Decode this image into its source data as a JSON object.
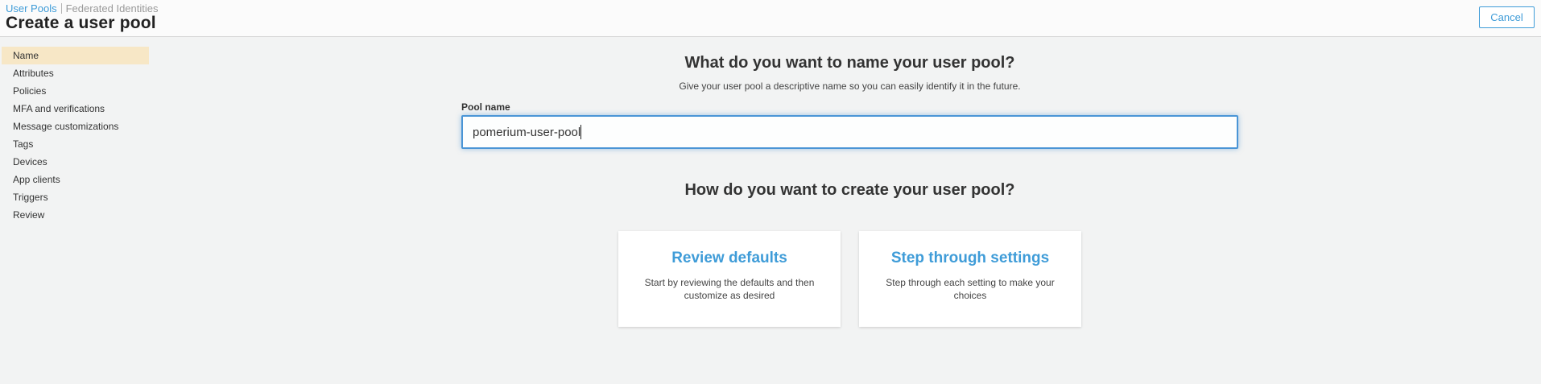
{
  "header": {
    "breadcrumb": {
      "user_pools": "User Pools",
      "federated_identities": "Federated Identities"
    },
    "title": "Create a user pool",
    "cancel_label": "Cancel"
  },
  "sidebar": {
    "items": [
      {
        "label": "Name",
        "active": true
      },
      {
        "label": "Attributes",
        "active": false
      },
      {
        "label": "Policies",
        "active": false
      },
      {
        "label": "MFA and verifications",
        "active": false
      },
      {
        "label": "Message customizations",
        "active": false
      },
      {
        "label": "Tags",
        "active": false
      },
      {
        "label": "Devices",
        "active": false
      },
      {
        "label": "App clients",
        "active": false
      },
      {
        "label": "Triggers",
        "active": false
      },
      {
        "label": "Review",
        "active": false
      }
    ]
  },
  "name_section": {
    "heading": "What do you want to name your user pool?",
    "subheading": "Give your user pool a descriptive name so you can easily identify it in the future.",
    "pool_name_label": "Pool name",
    "pool_name_value": "pomerium-user-pool"
  },
  "create_section": {
    "heading": "How do you want to create your user pool?",
    "cards": [
      {
        "title": "Review defaults",
        "description": "Start by reviewing the defaults and then customize as desired"
      },
      {
        "title": "Step through settings",
        "description": "Step through each setting to make your choices"
      }
    ]
  },
  "colors": {
    "accent": "#3f9cd8",
    "active_step_bg": "#f7e7c6",
    "input_border": "#4a95d6"
  }
}
